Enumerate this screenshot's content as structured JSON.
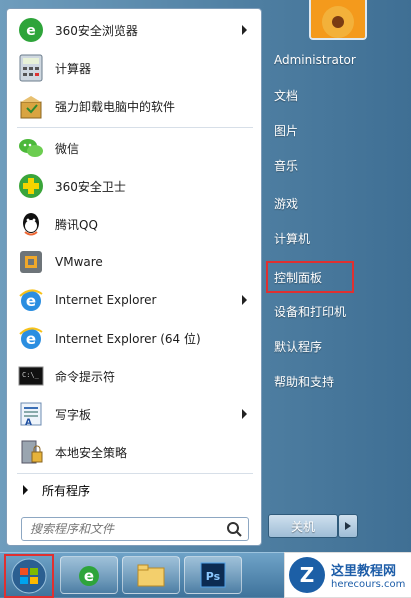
{
  "left_items": [
    {
      "label": "360安全浏览器",
      "icon": "360-browser-icon",
      "arrow": true
    },
    {
      "label": "计算器",
      "icon": "calculator-icon",
      "arrow": false
    },
    {
      "label": "强力卸载电脑中的软件",
      "icon": "uninstall-icon",
      "arrow": false
    },
    {
      "label": "微信",
      "icon": "wechat-icon",
      "arrow": false
    },
    {
      "label": "360安全卫士",
      "icon": "360-safe-icon",
      "arrow": false
    },
    {
      "label": "腾讯QQ",
      "icon": "qq-icon",
      "arrow": false
    },
    {
      "label": "VMware",
      "icon": "vmware-icon",
      "arrow": false
    },
    {
      "label": "Internet Explorer",
      "icon": "ie-icon",
      "arrow": true
    },
    {
      "label": "Internet Explorer (64 位)",
      "icon": "ie-icon",
      "arrow": false
    },
    {
      "label": "命令提示符",
      "icon": "cmd-icon",
      "arrow": false
    },
    {
      "label": "写字板",
      "icon": "wordpad-icon",
      "arrow": true
    },
    {
      "label": "本地安全策略",
      "icon": "security-policy-icon",
      "arrow": false
    }
  ],
  "all_programs": "所有程序",
  "search": {
    "placeholder": "搜索程序和文件"
  },
  "right_items": [
    "Administrator",
    "文档",
    "图片",
    "音乐",
    "游戏",
    "计算机",
    "控制面板",
    "设备和打印机",
    "默认程序",
    "帮助和支持"
  ],
  "shutdown": {
    "label": "关机"
  },
  "watermark": {
    "title": "这里教程网",
    "url": "herecours.com",
    "logo_letter": "Z"
  },
  "colors": {
    "highlight": "#e03030",
    "menu_blue": "#4f7fa2"
  }
}
